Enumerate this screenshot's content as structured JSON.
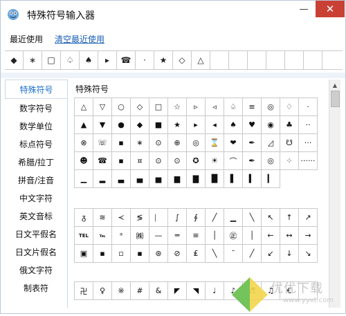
{
  "window": {
    "title": "特殊符号输入器",
    "min_glyph": "—",
    "close_glyph": "✕"
  },
  "menu": {
    "recent_label": "最近使用",
    "clear_label": "清空最近使用"
  },
  "recent": [
    "◆",
    "∗",
    "□",
    "♤",
    "♠",
    "▸",
    "☎",
    "·",
    "★",
    "◇",
    "△",
    "",
    "",
    "",
    "",
    "",
    ""
  ],
  "sidebar": {
    "items": [
      {
        "label": "特殊符号",
        "active": true
      },
      {
        "label": "数字符号",
        "active": false
      },
      {
        "label": "数学单位",
        "active": false
      },
      {
        "label": "标点符号",
        "active": false
      },
      {
        "label": "希腊/拉丁",
        "active": false
      },
      {
        "label": "拼音/注音",
        "active": false
      },
      {
        "label": "中文字符",
        "active": false
      },
      {
        "label": "英文音标",
        "active": false
      },
      {
        "label": "日文平假名",
        "active": false
      },
      {
        "label": "日文片假名",
        "active": false
      },
      {
        "label": "俄文字符",
        "active": false
      },
      {
        "label": "制表符",
        "active": false
      }
    ]
  },
  "section_title": "特殊符号",
  "grid1": [
    [
      "△",
      "▽",
      "○",
      "◇",
      "□",
      "☆",
      "▹",
      "◃",
      "♤",
      "≡",
      "◎",
      "♢",
      "·"
    ],
    [
      "▲",
      "▼",
      "●",
      "◆",
      "■",
      "★",
      "▸",
      "◂",
      "♠",
      "♥",
      "◉",
      "♣",
      "··"
    ],
    [
      "⊗",
      "☏",
      "▪",
      "∗",
      "⊙",
      "⊕",
      "◎",
      "⌛",
      "❤",
      "✒",
      "◿",
      "☋",
      "···"
    ],
    [
      "☻",
      "☎",
      "▪",
      "¤",
      "⊙",
      "⊙",
      "✪",
      "☀",
      "⌒",
      "✒",
      "◎",
      "⁘",
      "······"
    ],
    [
      "▁",
      "▂",
      "▃",
      "▄",
      "▅",
      "▆",
      "▇",
      "█",
      "▌",
      "▍",
      "▎"
    ]
  ],
  "grid2": [
    [
      "ᵹ",
      "≋",
      "≺",
      "≶",
      "︴",
      "∫",
      "∮",
      "╱",
      "▁",
      "╲",
      "↖",
      "↑",
      "↗"
    ],
    [
      "TEL",
      "℡",
      "ᵃ",
      "㈱",
      "—",
      "═",
      "≡",
      "│",
      "㊣",
      "│",
      "←",
      "↔",
      "→"
    ],
    [
      "▣",
      "▪",
      "▫",
      "▪",
      "⊛",
      "⊘",
      "₤",
      "╲",
      "¯",
      "╱",
      "↙",
      "↓",
      "↘"
    ]
  ],
  "grid3": [
    "卍",
    "♀",
    "※",
    "#",
    "&",
    "◤",
    "◥",
    "♩",
    "♪",
    "♬",
    "♫",
    "€",
    ""
  ],
  "watermark": {
    "text": "优优下载",
    "url": "www.yyxt.com"
  },
  "colors": {
    "close_red": "#c94035",
    "accent_blue": "#1a6fc9",
    "link_blue": "#1a5fb4"
  }
}
